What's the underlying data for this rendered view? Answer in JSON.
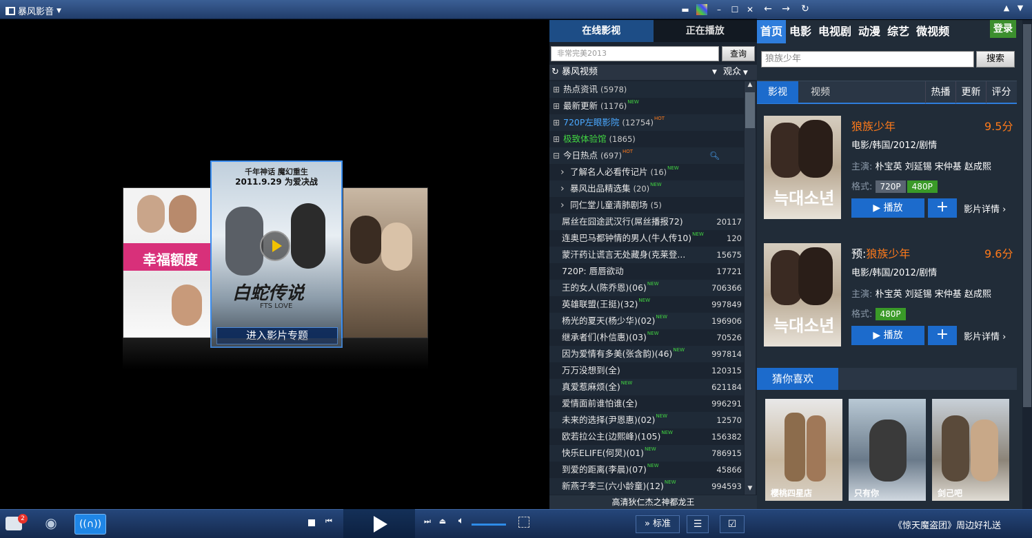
{
  "app": {
    "name": "暴风影音"
  },
  "panel": {
    "tabs": [
      "在线影视",
      "正在播放"
    ],
    "search_placeholder": "非常完美2013",
    "query_label": "查询",
    "source": "暴风视频",
    "sort": "观众",
    "footer": "高清狄仁杰之神都龙王",
    "items": [
      {
        "label": "热点资讯",
        "count": "(5978)",
        "type": "folder",
        "tag": ""
      },
      {
        "label": "最新更新",
        "count": "(1176)",
        "type": "folder",
        "tag": "NEW"
      },
      {
        "label": "720P左眼影院",
        "count": "(12754)",
        "type": "folder",
        "tag": "HOT",
        "color": "#4aa8ff"
      },
      {
        "label": "极致体验馆",
        "count": "(1865)",
        "type": "folder",
        "tag": "",
        "color": "#42d642"
      },
      {
        "label": "今日热点",
        "count": "(697)",
        "type": "folder-open",
        "tag": "HOT"
      },
      {
        "label": "了解名人必看传记片",
        "count": "(16)",
        "type": "sub",
        "tag": "NEW"
      },
      {
        "label": "暴风出品精选集",
        "count": "(20)",
        "type": "sub",
        "tag": "NEW"
      },
      {
        "label": "同仁堂儿童清肺剧场",
        "count": "(5)",
        "type": "sub",
        "tag": ""
      },
      {
        "label": "屌丝在囧途武汉行(屌丝播报72)",
        "num": "20117",
        "type": "video",
        "tag": ""
      },
      {
        "label": "连奥巴马都钟情的男人(牛人传10)",
        "num": "120",
        "type": "video",
        "tag": "NEW"
      },
      {
        "label": "蒙汗药让谎言无处藏身(克莱登...",
        "num": "15675",
        "type": "video",
        "tag": ""
      },
      {
        "label": "720P: 唇唇欲动",
        "num": "17721",
        "type": "video",
        "tag": ""
      },
      {
        "label": "王的女人(陈乔恩)(06)",
        "num": "706366",
        "type": "video",
        "tag": "NEW"
      },
      {
        "label": "英雄联盟(王挺)(32)",
        "num": "997849",
        "type": "video",
        "tag": "NEW"
      },
      {
        "label": "杨光的夏天(杨少华)(02)",
        "num": "196906",
        "type": "video",
        "tag": "NEW"
      },
      {
        "label": "继承者们(朴信惠)(03)",
        "num": "70526",
        "type": "video",
        "tag": "NEW"
      },
      {
        "label": "因为爱情有多美(张含韵)(46)",
        "num": "997814",
        "type": "video",
        "tag": "NEW"
      },
      {
        "label": "万万没想到(全)",
        "num": "120315",
        "type": "video",
        "tag": ""
      },
      {
        "label": "真爱惹麻烦(全)",
        "num": "621184",
        "type": "video",
        "tag": "NEW"
      },
      {
        "label": "爱情面前谁怕谁(全)",
        "num": "996291",
        "type": "video",
        "tag": ""
      },
      {
        "label": "未来的选择(尹恩惠)(02)",
        "num": "12570",
        "type": "video",
        "tag": "NEW"
      },
      {
        "label": "欧若拉公主(边熙峰)(105)",
        "num": "156382",
        "type": "video",
        "tag": "NEW"
      },
      {
        "label": "快乐ELIFE(何炅)(01)",
        "num": "786915",
        "type": "video",
        "tag": "NEW"
      },
      {
        "label": "到爱的距离(李晨)(07)",
        "num": "45866",
        "type": "video",
        "tag": "NEW"
      },
      {
        "label": "新燕子李三(六小龄童)(12)",
        "num": "994593",
        "type": "video",
        "tag": "NEW"
      }
    ]
  },
  "right": {
    "nav": [
      "首页",
      "电影",
      "电视剧",
      "动漫",
      "综艺",
      "微视频"
    ],
    "login": "登录",
    "search_value": "狼族少年",
    "search_btn": "搜索",
    "tabs": [
      "影视",
      "视频"
    ],
    "sort": [
      "热播",
      "更新",
      "评分"
    ],
    "cards": [
      {
        "prefix": "",
        "title": "狼族少年",
        "score": "9.5分",
        "meta": "电影/韩国/2012/剧情",
        "cast_label": "主演:",
        "cast": "朴宝英 刘延锡 宋仲基 赵成熙",
        "fmt_label": "格式:",
        "formats": [
          "720P",
          "480P"
        ],
        "play": "播放",
        "detail": "影片详情"
      },
      {
        "prefix": "预:",
        "title": "狼族少年",
        "score": "9.6分",
        "meta": "电影/韩国/2012/剧情",
        "cast_label": "主演:",
        "cast": "朴宝英 刘延锡 宋仲基 赵成熙",
        "fmt_label": "格式:",
        "formats": [
          "480P"
        ],
        "play": "播放",
        "detail": "影片详情"
      }
    ],
    "guess": "猜你喜欢",
    "guess_titles": [
      "樱桃四星店",
      "只有你",
      "剑己吧"
    ]
  },
  "player": {
    "poster_big_top": "千年神话 魔幻重生",
    "poster_big_date": "2011.9.29 为爱决战",
    "poster_big_title": "白蛇传说",
    "poster_big_sub": "FTS LOVE",
    "poster_left_title": "幸福额度",
    "enter_label": "进入影片专题"
  },
  "bottom": {
    "badge": "2",
    "quality": "标准",
    "promo": "《惊天魔盗团》周边好礼送"
  }
}
